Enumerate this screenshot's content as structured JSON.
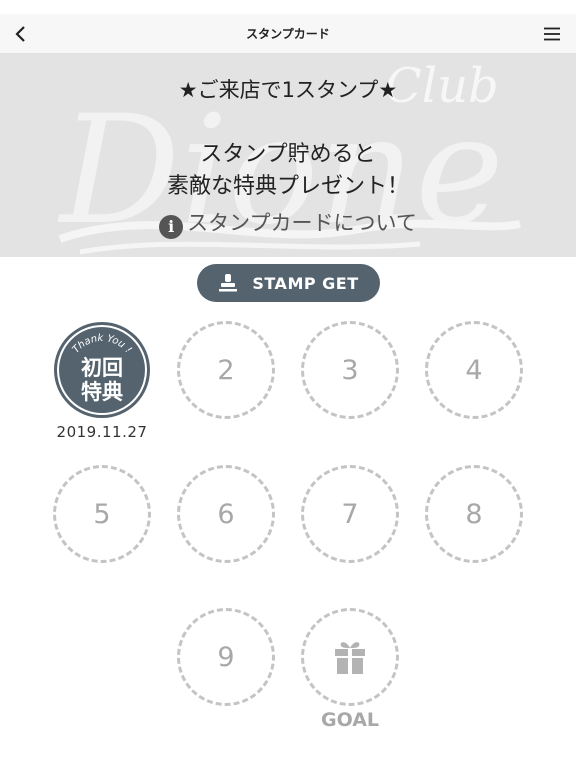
{
  "nav": {
    "title": "スタンプカード",
    "back_icon": "chevron-left-icon",
    "menu_icon": "hamburger-menu-icon"
  },
  "banner": {
    "logo_text": "Club Dione",
    "headline": "★ご来店で1スタンプ★",
    "description_line1": "スタンプ貯めると",
    "description_line2": "素敵な特典プレゼント！",
    "info_icon_char": "i",
    "info_link": "スタンプカードについて"
  },
  "stamp_button": {
    "label": "STAMP GET",
    "icon": "stamp-icon"
  },
  "card": {
    "stamped": [
      {
        "number": 1,
        "badge_top": "Thank You !",
        "badge_line1": "初回",
        "badge_line2": "特典",
        "date": "2019.11.27"
      }
    ],
    "empty_slots": [
      "2",
      "3",
      "4",
      "5",
      "6",
      "7",
      "8",
      "9"
    ],
    "goal": {
      "label": "GOAL",
      "icon": "gift-icon"
    }
  },
  "colors": {
    "accent": "#55636f",
    "slot_border": "#c4c4c4",
    "slot_text": "#a8a8a8",
    "banner_bg": "#e3e3e3"
  }
}
